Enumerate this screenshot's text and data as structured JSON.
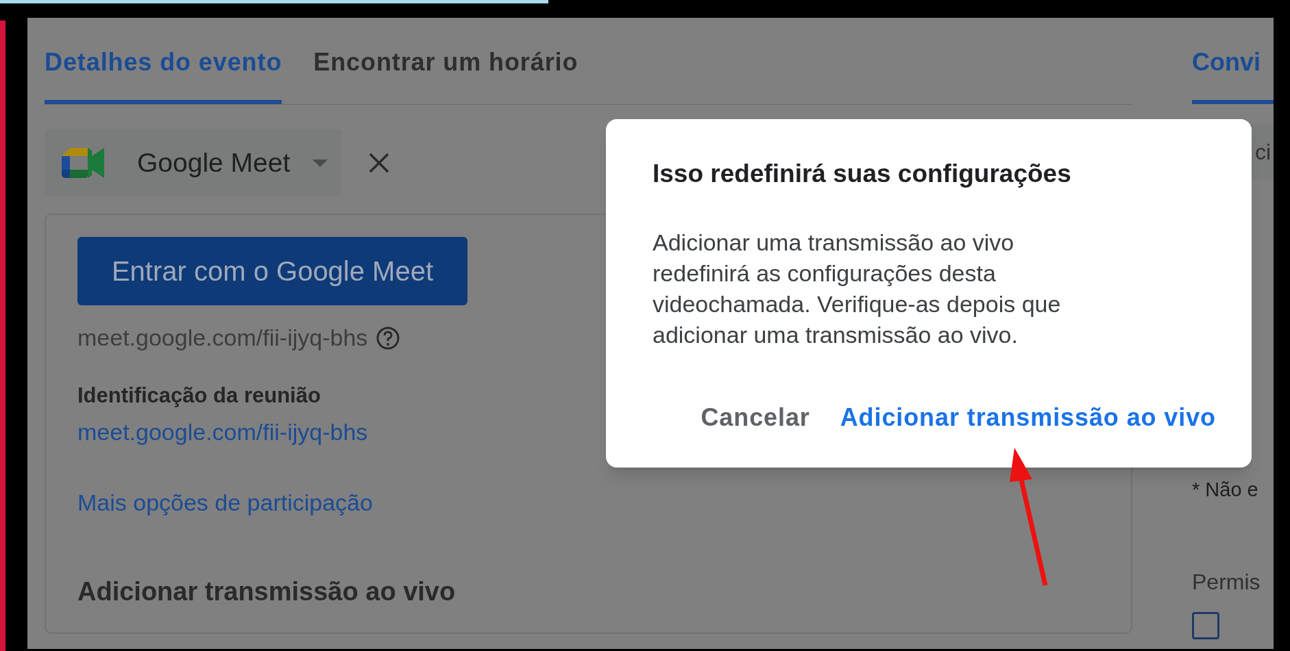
{
  "tabs": [
    {
      "label": "Detalhes do evento",
      "selected": true
    },
    {
      "label": "Encontrar um horário",
      "selected": false
    }
  ],
  "conference": {
    "provider": "Google Meet",
    "join_button": "Entrar com o Google Meet",
    "link": "meet.google.com/fii-ijyq-bhs",
    "meeting_id_label": "Identificação da reunião",
    "meeting_id_link": "meet.google.com/fii-ijyq-bhs",
    "more_options": "Mais opções de participação",
    "add_livestream": "Adicionar transmissão ao vivo"
  },
  "side_panel": {
    "tab": {
      "label": "Convi",
      "selected": true
    },
    "field_fragment": "ci",
    "note": "* Não e",
    "section": "Permis",
    "checkbox": {
      "checked": false
    }
  },
  "dialog": {
    "title": "Isso redefinirá suas configurações",
    "body": "Adicionar uma transmissão ao vivo redefinirá as configurações desta videochamada. Verifique-as depois que adicionar uma transmissão ao vivo.",
    "buttons": [
      {
        "label": "Cancelar",
        "kind": "secondary"
      },
      {
        "label": "Adicionar transmissão ao vivo",
        "kind": "primary"
      }
    ]
  }
}
